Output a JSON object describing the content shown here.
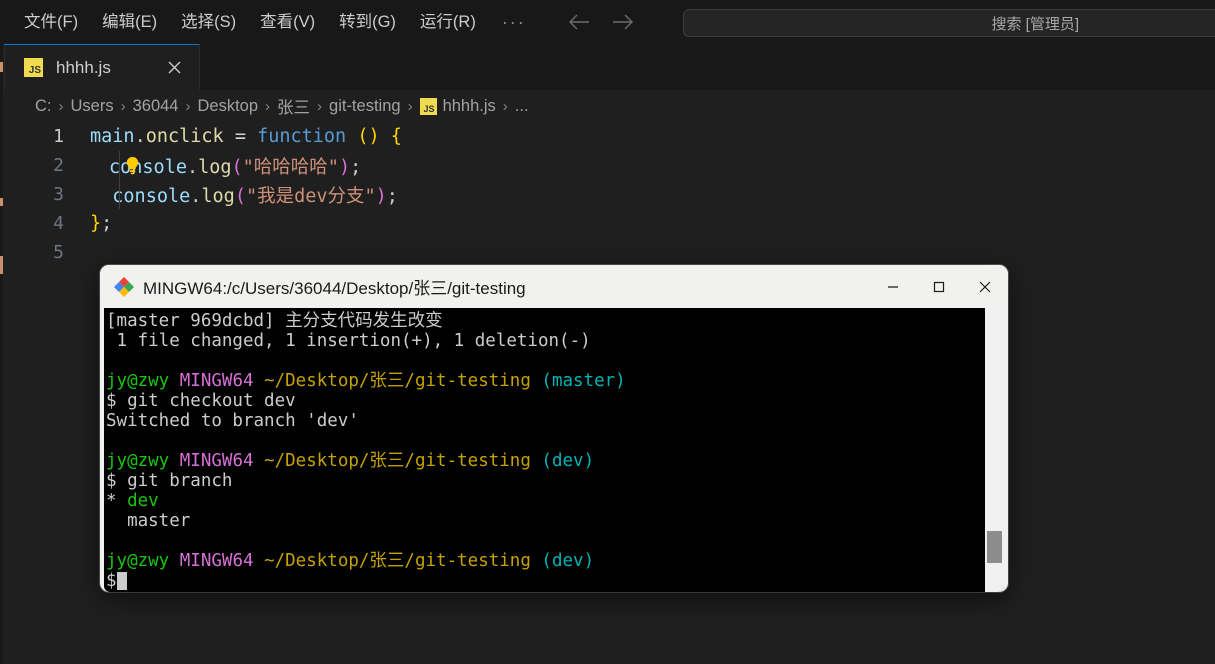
{
  "window": {
    "menu": [
      {
        "label": "文件(F)",
        "name": "menu-file"
      },
      {
        "label": "编辑(E)",
        "name": "menu-edit"
      },
      {
        "label": "选择(S)",
        "name": "menu-selection"
      },
      {
        "label": "查看(V)",
        "name": "menu-view"
      },
      {
        "label": "转到(G)",
        "name": "menu-go"
      },
      {
        "label": "运行(R)",
        "name": "menu-run"
      }
    ],
    "menu_overflow": "···",
    "nav_back": "←",
    "nav_forward": "→",
    "search": {
      "label": "搜索 [管理员]",
      "icon": "search-icon",
      "value": ""
    }
  },
  "tabs": [
    {
      "label": "hhhh.js",
      "icon_text": "JS",
      "icon_color": "#f0db4f",
      "close": "✕",
      "active": true
    }
  ],
  "breadcrumb": {
    "separator": "›",
    "items": [
      {
        "label": "C:"
      },
      {
        "label": "Users"
      },
      {
        "label": "36044"
      },
      {
        "label": "Desktop"
      },
      {
        "label": "张三"
      },
      {
        "label": "git-testing"
      },
      {
        "label": "hhhh.js",
        "icon_text": "JS"
      },
      {
        "label": "..."
      }
    ]
  },
  "editor": {
    "line_numbers": [
      "1",
      "2",
      "3",
      "4",
      "5"
    ],
    "active_line": "1",
    "bulb_icon": "lightbulb-icon",
    "lines": [
      {
        "num": "1",
        "tokens": [
          {
            "text": "main",
            "cls": "t-var"
          },
          {
            "text": ".",
            "cls": "t-punct"
          },
          {
            "text": "onclick",
            "cls": "t-prop"
          },
          {
            "text": " ",
            "cls": "t-op"
          },
          {
            "text": "=",
            "cls": "t-op"
          },
          {
            "text": " ",
            "cls": "t-op"
          },
          {
            "text": "function",
            "cls": "t-kw"
          },
          {
            "text": " ",
            "cls": "t-op"
          },
          {
            "text": "()",
            "cls": "t-paren"
          },
          {
            "text": " ",
            "cls": "t-op"
          },
          {
            "text": "{",
            "cls": "t-paren"
          }
        ]
      },
      {
        "num": "2",
        "bulb": true,
        "tokens": [
          {
            "text": "console",
            "cls": "t-var"
          },
          {
            "text": ".",
            "cls": "t-punct"
          },
          {
            "text": "log",
            "cls": "t-prop"
          },
          {
            "text": "(",
            "cls": "t-paren2"
          },
          {
            "text": "\"哈哈哈哈\"",
            "cls": "t-str"
          },
          {
            "text": ")",
            "cls": "t-paren2"
          },
          {
            "text": ";",
            "cls": "t-punct"
          }
        ]
      },
      {
        "num": "3",
        "tokens": [
          {
            "text": "  ",
            "cls": "t-op"
          },
          {
            "text": "console",
            "cls": "t-var"
          },
          {
            "text": ".",
            "cls": "t-punct"
          },
          {
            "text": "log",
            "cls": "t-prop"
          },
          {
            "text": "(",
            "cls": "t-paren2"
          },
          {
            "text": "\"我是dev分支\"",
            "cls": "t-str"
          },
          {
            "text": ")",
            "cls": "t-paren2"
          },
          {
            "text": ";",
            "cls": "t-punct"
          }
        ]
      },
      {
        "num": "4",
        "tokens": [
          {
            "text": "}",
            "cls": "t-paren"
          },
          {
            "text": ";",
            "cls": "t-punct"
          }
        ]
      },
      {
        "num": "5",
        "tokens": []
      }
    ]
  },
  "terminal": {
    "title": "MINGW64:/c/Users/36044/Desktop/张三/git-testing",
    "icon": "git-bash-icon",
    "controls": {
      "minimize": "minimize-button",
      "maximize": "maximize-button",
      "close": "close-button"
    },
    "scrollbar": {
      "name": "terminal-scrollbar"
    },
    "rows": [
      [
        {
          "text": "[master 969dcbd] ",
          "cls": "c-white"
        },
        {
          "text": "主分支代码发生改变",
          "cls": "c-white"
        }
      ],
      [
        {
          "text": " 1 file changed, 1 insertion(+), 1 deletion(-)",
          "cls": "c-white"
        }
      ],
      [],
      [
        {
          "text": "jy@zwy",
          "cls": "c-green"
        },
        {
          "text": " ",
          "cls": "c-white"
        },
        {
          "text": "MINGW64",
          "cls": "c-magenta"
        },
        {
          "text": " ",
          "cls": "c-white"
        },
        {
          "text": "~/Desktop/张三/git-testing",
          "cls": "c-yellow"
        },
        {
          "text": " ",
          "cls": "c-white"
        },
        {
          "text": "(master)",
          "cls": "c-teal"
        }
      ],
      [
        {
          "text": "$ git checkout dev",
          "cls": "c-white"
        }
      ],
      [
        {
          "text": "Switched to branch 'dev'",
          "cls": "c-white"
        }
      ],
      [],
      [
        {
          "text": "jy@zwy",
          "cls": "c-green"
        },
        {
          "text": " ",
          "cls": "c-white"
        },
        {
          "text": "MINGW64",
          "cls": "c-magenta"
        },
        {
          "text": " ",
          "cls": "c-white"
        },
        {
          "text": "~/Desktop/张三/git-testing",
          "cls": "c-yellow"
        },
        {
          "text": " ",
          "cls": "c-white"
        },
        {
          "text": "(dev)",
          "cls": "c-teal"
        }
      ],
      [
        {
          "text": "$ git branch",
          "cls": "c-white"
        }
      ],
      [
        {
          "text": "* ",
          "cls": "c-white"
        },
        {
          "text": "dev",
          "cls": "c-green"
        }
      ],
      [
        {
          "text": "  master",
          "cls": "c-white"
        }
      ],
      [],
      [
        {
          "text": "jy@zwy",
          "cls": "c-green"
        },
        {
          "text": " ",
          "cls": "c-white"
        },
        {
          "text": "MINGW64",
          "cls": "c-magenta"
        },
        {
          "text": " ",
          "cls": "c-white"
        },
        {
          "text": "~/Desktop/张三/git-testing",
          "cls": "c-yellow"
        },
        {
          "text": " ",
          "cls": "c-white"
        },
        {
          "text": "(dev)",
          "cls": "c-teal"
        }
      ],
      [
        {
          "text": "$",
          "cls": "c-white",
          "cursor": true
        }
      ]
    ]
  },
  "colors": {
    "editor_bg": "#1f1f1f",
    "chrome_bg": "#181818",
    "accent": "#0078d4",
    "js_yellow": "#f0db4f",
    "terminal_bg": "#000000"
  }
}
